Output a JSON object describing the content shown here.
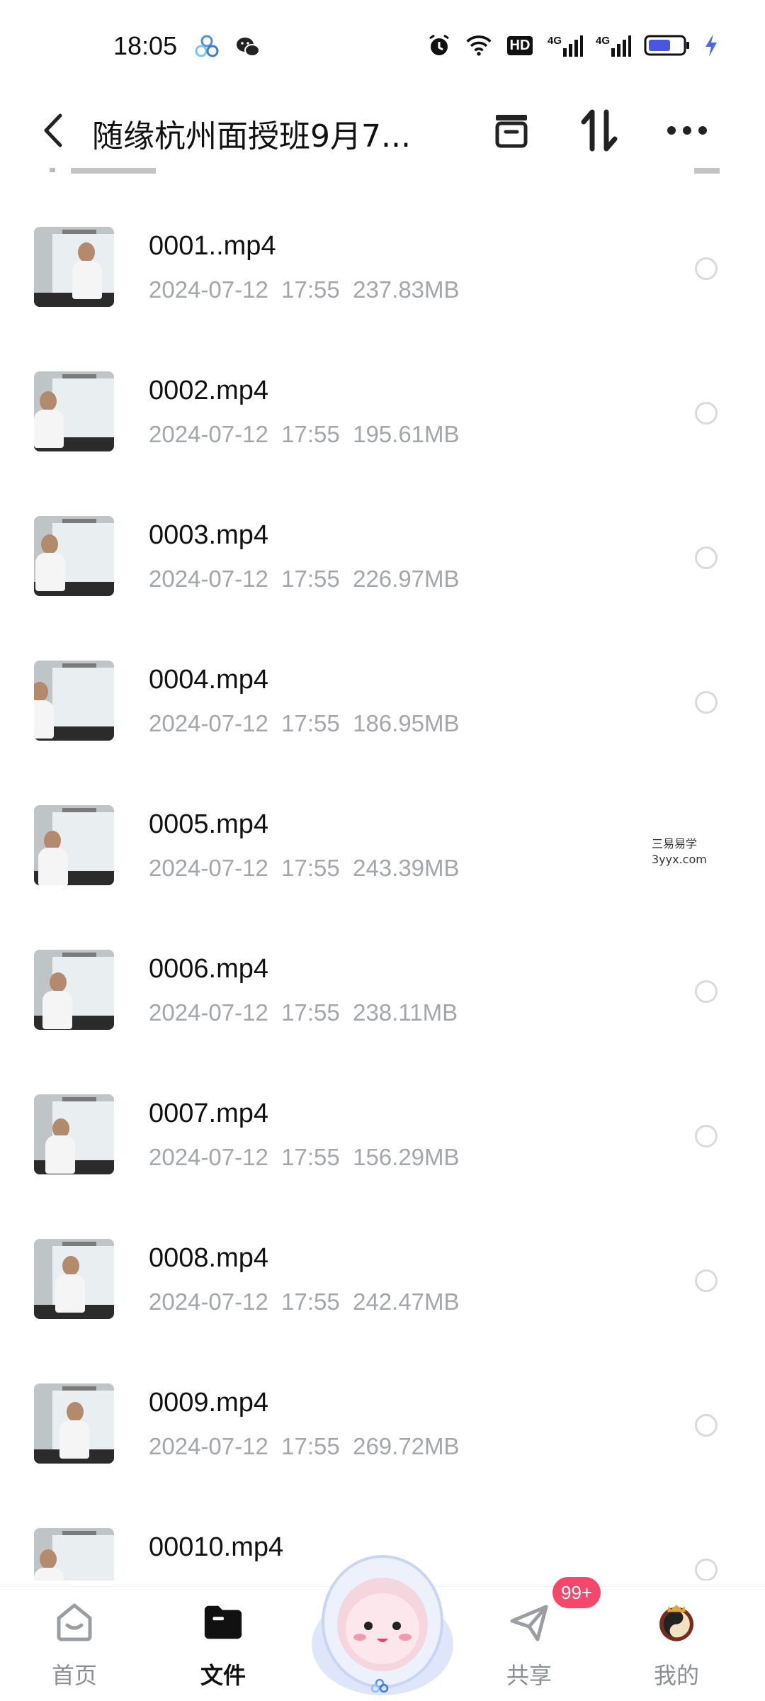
{
  "status_bar": {
    "time": "18:05",
    "left_icons": [
      "app-notification-icon",
      "wechat-icon"
    ],
    "right_icons": [
      "alarm-icon",
      "wifi-icon",
      "hd-icon",
      "signal-4g-icon",
      "signal-4g-icon",
      "battery-icon",
      "charging-icon"
    ],
    "hd_text": "HD",
    "net_text": "4G"
  },
  "header": {
    "title": "随缘杭州面授班9月7...",
    "back_icon": "chevron-left-icon",
    "actions": [
      "archive-box-icon",
      "sort-icon",
      "more-icon"
    ]
  },
  "files": [
    {
      "name": "0001..mp4",
      "date": "2024-07-12",
      "time": "17:55",
      "size": "237.83MB"
    },
    {
      "name": "0002.mp4",
      "date": "2024-07-12",
      "time": "17:55",
      "size": "195.61MB"
    },
    {
      "name": "0003.mp4",
      "date": "2024-07-12",
      "time": "17:55",
      "size": "226.97MB"
    },
    {
      "name": "0004.mp4",
      "date": "2024-07-12",
      "time": "17:55",
      "size": "186.95MB"
    },
    {
      "name": "0005.mp4",
      "date": "2024-07-12",
      "time": "17:55",
      "size": "243.39MB"
    },
    {
      "name": "0006.mp4",
      "date": "2024-07-12",
      "time": "17:55",
      "size": "238.11MB"
    },
    {
      "name": "0007.mp4",
      "date": "2024-07-12",
      "time": "17:55",
      "size": "156.29MB"
    },
    {
      "name": "0008.mp4",
      "date": "2024-07-12",
      "time": "17:55",
      "size": "242.47MB"
    },
    {
      "name": "0009.mp4",
      "date": "2024-07-12",
      "time": "17:55",
      "size": "269.72MB"
    },
    {
      "name": "00010.mp4",
      "date": "",
      "time": "",
      "size": ""
    }
  ],
  "watermark": {
    "line1": "三易易学",
    "line2": "3yyx.com"
  },
  "bottom_nav": {
    "items": [
      {
        "label": "首页",
        "icon": "home-icon",
        "active": false
      },
      {
        "label": "文件",
        "icon": "folder-icon",
        "active": true
      },
      {
        "label": "共享",
        "icon": "paper-plane-icon",
        "active": false
      },
      {
        "label": "我的",
        "icon": "avatar-icon",
        "active": false
      }
    ],
    "share_badge": "99+",
    "center_icon": "mascot-assistant-icon"
  },
  "colors": {
    "accent": "#f4476b",
    "meta_text": "#a3a6ab",
    "active_tab": "#111111"
  }
}
